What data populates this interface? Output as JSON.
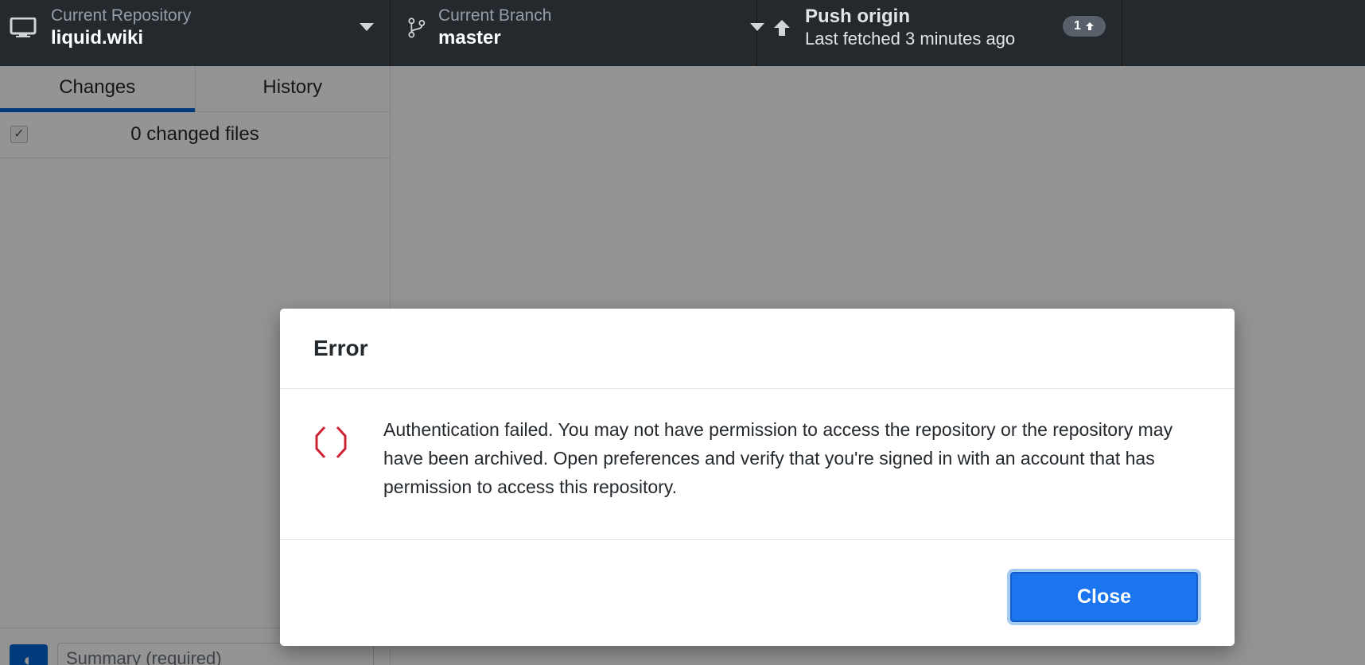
{
  "toolbar": {
    "repository": {
      "label": "Current Repository",
      "value": "liquid.wiki",
      "icon": "desktop-icon"
    },
    "branch": {
      "label": "Current Branch",
      "value": "master",
      "icon": "git-branch-icon"
    },
    "push": {
      "title": "Push origin",
      "subtitle": "Last fetched 3 minutes ago",
      "badge_count": "1",
      "icon": "arrow-up-icon"
    }
  },
  "sidebar": {
    "tabs": [
      {
        "label": "Changes",
        "active": true
      },
      {
        "label": "History",
        "active": false
      }
    ],
    "changes_header": {
      "checked": true,
      "count_text": "0 changed files"
    },
    "commit": {
      "summary_placeholder": "Summary (required)"
    }
  },
  "dialog": {
    "title": "Error",
    "icon": "stop-octagon-icon",
    "message": "Authentication failed. You may not have permission to access the repository or the repository may have been archived. Open preferences and verify that you're signed in with an account that has permission to access this repository.",
    "close_label": "Close"
  },
  "colors": {
    "toolbar_bg": "#24292e",
    "accent": "#0366d6",
    "primary_button": "#1b75ee",
    "error_icon": "#cb2431"
  }
}
